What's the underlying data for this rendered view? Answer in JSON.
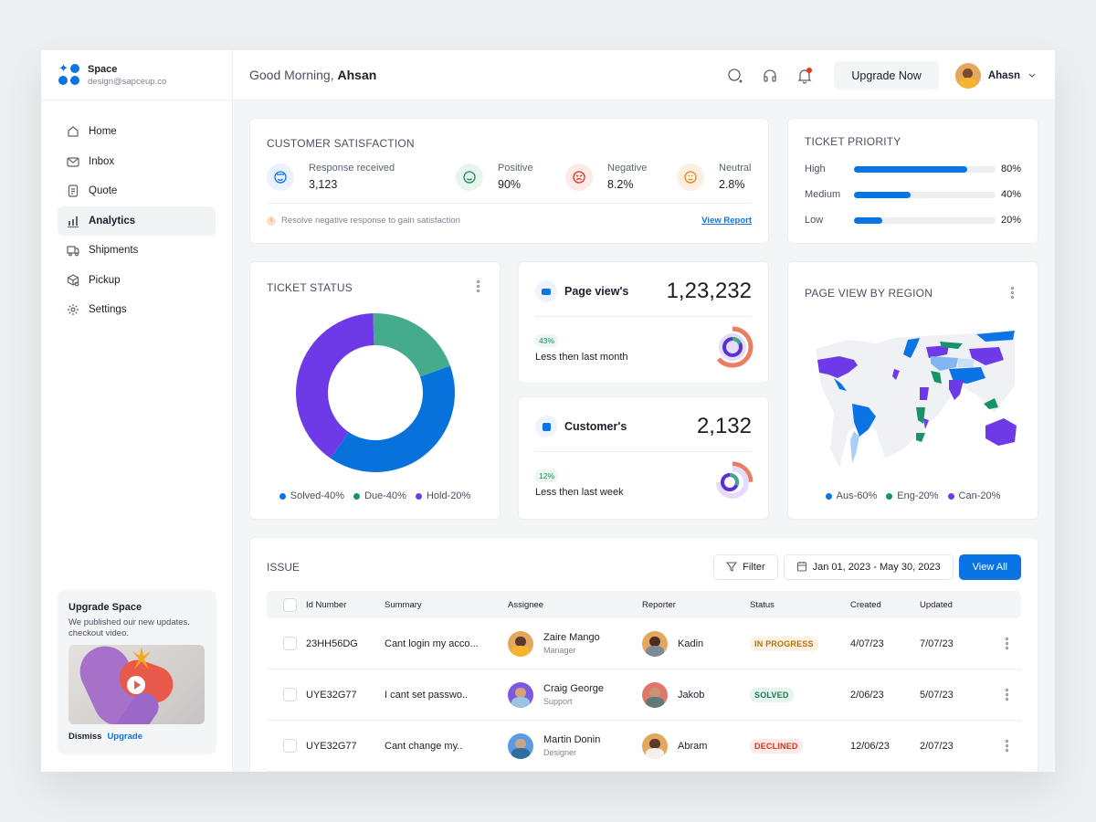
{
  "brand": {
    "name": "Space",
    "email": "design@sapceup.co",
    "color": "#0b74e5"
  },
  "sidebar": {
    "items": [
      {
        "label": "Home",
        "icon": "home-icon",
        "active": false
      },
      {
        "label": "Inbox",
        "icon": "mail-icon",
        "active": false
      },
      {
        "label": "Quote",
        "icon": "document-icon",
        "active": false
      },
      {
        "label": "Analytics",
        "icon": "bar-chart-icon",
        "active": true
      },
      {
        "label": "Shipments",
        "icon": "truck-icon",
        "active": false
      },
      {
        "label": "Pickup",
        "icon": "package-search-icon",
        "active": false
      },
      {
        "label": "Settings",
        "icon": "gear-icon",
        "active": false
      }
    ],
    "upgrade": {
      "title": "Upgrade Space",
      "text": "We published our new updates. checkout video.",
      "dismiss": "Dismiss",
      "upgrade": "Upgrade"
    }
  },
  "header": {
    "greeting": "Good Morning,",
    "name": "Ahsan",
    "upgrade_button": "Upgrade Now",
    "user_name": "Ahasn"
  },
  "customer_satisfaction": {
    "title": "CUSTOMER SATISFACTION",
    "items": [
      {
        "label": "Response received",
        "value": "3,123",
        "icon": "smile-halo-icon",
        "bg": "#e9f2fd",
        "color": "#0b74e5"
      },
      {
        "label": "Positive",
        "value": "90%",
        "icon": "happy-face-icon",
        "bg": "#e8f5ef",
        "color": "#1b8a5a"
      },
      {
        "label": "Negative",
        "value": "8.2%",
        "icon": "angry-face-icon",
        "bg": "#fde9e7",
        "color": "#d9321f"
      },
      {
        "label": "Neutral",
        "value": "2.8%",
        "icon": "neutral-face-icon",
        "bg": "#fdf0e3",
        "color": "#e8820c"
      }
    ],
    "note": "Resolve negative response to gain satisfaction",
    "link": "View Report"
  },
  "ticket_priority": {
    "title": "TICKET PRIORITY",
    "rows": [
      {
        "label": "High",
        "value": 80,
        "display": "80%"
      },
      {
        "label": "Medium",
        "value": 40,
        "display": "40%"
      },
      {
        "label": "Low",
        "value": 20,
        "display": "20%"
      }
    ]
  },
  "ticket_status": {
    "title": "TICKET STATUS",
    "legend": [
      {
        "label": "Solved-40%",
        "color": "#0b74e5"
      },
      {
        "label": "Due-40%",
        "color": "#17936a"
      },
      {
        "label": "Hold-20%",
        "color": "#6e3ae8"
      }
    ]
  },
  "chart_data": {
    "type": "pie",
    "title": "TICKET STATUS",
    "categories": [
      "Solved",
      "Due",
      "Hold"
    ],
    "values": [
      40,
      20,
      40
    ],
    "legend_labels": [
      "Solved-40%",
      "Due-40%",
      "Hold-20%"
    ],
    "colors": [
      "#0872dc",
      "#45ab8d",
      "#6e3ae8"
    ],
    "legend": "bottom"
  },
  "page_views": {
    "label": "Page view's",
    "value": "1,23,232",
    "badge": "43%",
    "text": "Less then last month"
  },
  "customers": {
    "label": "Customer's",
    "value": "2,132",
    "badge": "12%",
    "text": "Less then last week"
  },
  "region": {
    "title": "PAGE VIEW BY REGION",
    "legend": [
      {
        "label": "Aus-60%",
        "color": "#0b74e5"
      },
      {
        "label": "Eng-20%",
        "color": "#17936a"
      },
      {
        "label": "Can-20%",
        "color": "#6e3ae8"
      }
    ]
  },
  "issues": {
    "title": "ISSUE",
    "filter": "Filter",
    "date_range": "Jan 01, 2023 - May 30, 2023",
    "view_all": "View All",
    "columns": [
      "Id Number",
      "Summary",
      "Assignee",
      "Reporter",
      "Status",
      "Created",
      "Updated"
    ],
    "rows": [
      {
        "id": "23HH56DG",
        "summary": "Cant login my acco...",
        "assignee": "Zaire Mango",
        "role": "Manager",
        "reporter": "Kadin",
        "status": "IN PROGRESS",
        "status_fg": "#b86e07",
        "status_bg": "#fdf3e4",
        "created": "4/07/23",
        "updated": "7/07/23"
      },
      {
        "id": "UYE32G77",
        "summary": "I cant set passwo..",
        "assignee": "Craig George",
        "role": "Support",
        "reporter": "Jakob",
        "status": "SOLVED",
        "status_fg": "#1b7a52",
        "status_bg": "#e6f5ee",
        "created": "2/06/23",
        "updated": "5/07/23"
      },
      {
        "id": "UYE32G77",
        "summary": "Cant change my..",
        "assignee": "Martin Donin",
        "role": "Designer",
        "reporter": "Abram",
        "status": "DECLINED",
        "status_fg": "#d3321e",
        "status_bg": "#fde9e7",
        "created": "12/06/23",
        "updated": "2/07/23"
      }
    ]
  }
}
